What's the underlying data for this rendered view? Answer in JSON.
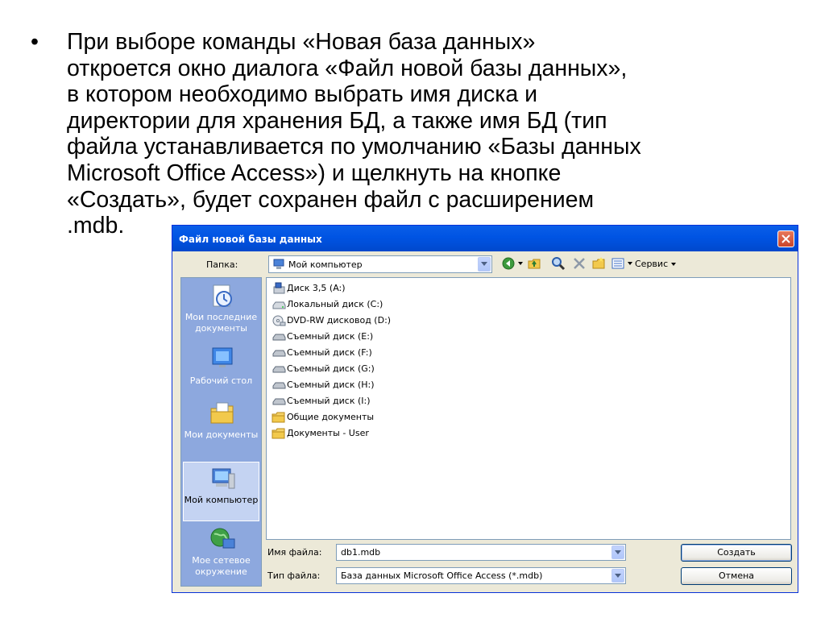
{
  "slide": {
    "bullet": "•",
    "lines": [
      "При выборе команды «Новая база данных»",
      "откроется окно диалога «Файл новой базы данных»,",
      "в котором необходимо выбрать имя диска и",
      "директории для хранения БД, а также имя БД (тип",
      "файла устанавливается по умолчанию «Базы данных",
      "Microsoft Office Access») и щелкнуть на кнопке",
      "«Создать», будет сохранен файл с расширением",
      ".mdb."
    ]
  },
  "dialog": {
    "title": "Файл новой базы данных",
    "folder_label": "Папка:",
    "folder_value": "Мой компьютер",
    "service_label": "Сервис",
    "places": [
      {
        "label": "Мои последние документы",
        "icon": "recent-documents-icon"
      },
      {
        "label": "Рабочий стол",
        "icon": "desktop-icon"
      },
      {
        "label": "Мои документы",
        "icon": "my-documents-icon"
      },
      {
        "label": "Мой компьютер",
        "icon": "my-computer-icon",
        "selected": true
      },
      {
        "label": "Мое сетевое окружение",
        "icon": "network-places-icon"
      }
    ],
    "files": [
      {
        "name": "Диск 3,5 (A:)",
        "icon": "floppy-drive-icon"
      },
      {
        "name": "Локальный диск (C:)",
        "icon": "hard-drive-icon"
      },
      {
        "name": "DVD-RW дисковод (D:)",
        "icon": "dvd-drive-icon"
      },
      {
        "name": "Съемный диск (E:)",
        "icon": "removable-drive-icon"
      },
      {
        "name": "Съемный диск (F:)",
        "icon": "removable-drive-icon"
      },
      {
        "name": "Съемный диск (G:)",
        "icon": "removable-drive-icon"
      },
      {
        "name": "Съемный диск (H:)",
        "icon": "removable-drive-icon"
      },
      {
        "name": "Съемный диск (I:)",
        "icon": "removable-drive-icon"
      },
      {
        "name": "Общие документы",
        "icon": "folder-icon"
      },
      {
        "name": "Документы - User",
        "icon": "folder-icon"
      }
    ],
    "filename_label": "Имя файла:",
    "filename_value": "db1.mdb",
    "filetype_label": "Тип файла:",
    "filetype_value": "База данных Microsoft Office Access (*.mdb)",
    "create_button": "Создать",
    "cancel_button": "Отмена"
  },
  "colors": {
    "titlebar": "#0054E3",
    "dialog_bg": "#ECE9D8",
    "places_bg": "#8DA8DE",
    "close_button": "#D4532F"
  }
}
